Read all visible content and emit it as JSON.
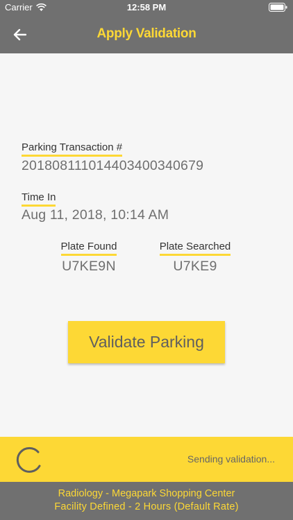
{
  "status_bar": {
    "carrier": "Carrier",
    "time": "12:58 PM"
  },
  "nav": {
    "title": "Apply Validation"
  },
  "transaction": {
    "label": "Parking Transaction #",
    "value": "20180811101440340034067​9"
  },
  "time_in": {
    "label": "Time In",
    "value": "Aug 11, 2018, 10:14 AM"
  },
  "plate_found": {
    "label": "Plate Found",
    "value": "U7KE9N"
  },
  "plate_searched": {
    "label": "Plate Searched",
    "value": "U7KE9"
  },
  "validate_button": {
    "label": "Validate Parking"
  },
  "status_panel": {
    "message": "Sending validation..."
  },
  "footer": {
    "line1": "Radiology - Megapark Shopping Center",
    "line2": "Facility Defined - 2 Hours (Default Rate)"
  },
  "colors": {
    "accent": "#fdd835",
    "bar": "#707070",
    "background": "#f6f6f6"
  }
}
